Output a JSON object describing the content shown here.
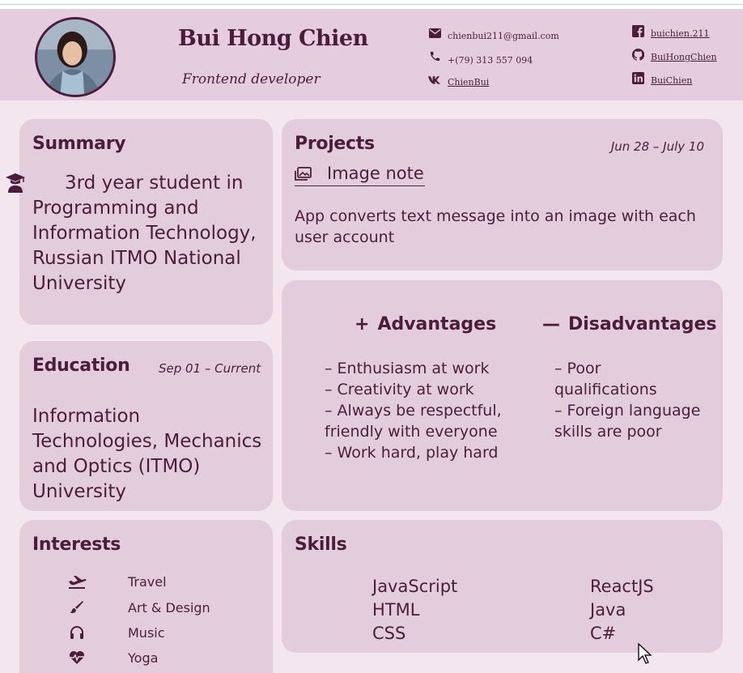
{
  "header": {
    "name": "Bui Hong Chien",
    "role": "Frontend developer",
    "email": "chienbui211@gmail.com",
    "phone": "+(79) 313 557 094",
    "vk": "ChienBui",
    "facebook": "buichien.211",
    "github": "BuiHongChien",
    "linkedin": "BuiChien"
  },
  "summary": {
    "title": "Summary",
    "text": "3rd year student in Programming and Information Technology, Russian ITMO National University"
  },
  "education": {
    "title": "Education",
    "date": "Sep 01 – Current",
    "text": "Information Technologies, Mechanics and Optics (ITMO) University"
  },
  "interests": {
    "title": "Interests",
    "items": [
      {
        "label": "Travel",
        "icon": "plane-icon"
      },
      {
        "label": "Art & Design",
        "icon": "brush-icon"
      },
      {
        "label": "Music",
        "icon": "headphones-icon"
      },
      {
        "label": "Yoga",
        "icon": "heartbeat-icon"
      }
    ]
  },
  "projects": {
    "title": "Projects",
    "date": "Jun 28 – July 10",
    "project_name": "Image note",
    "description": "App converts text message into an image with each user account"
  },
  "pros_cons": {
    "advantages_title": "Advantages",
    "advantages_sign": "+",
    "advantages": [
      "– Enthusiasm at work",
      "– Creativity at work",
      "– Always be respectful, friendly with everyone",
      "– Work hard, play hard"
    ],
    "disadvantages_title": "Disadvantages",
    "disadvantages_sign": "—",
    "disadvantages": [
      "– Poor qualifications",
      "– Foreign language skills are poor"
    ]
  },
  "skills": {
    "title": "Skills",
    "col1": [
      "JavaScript",
      "HTML",
      "CSS"
    ],
    "col2": [
      "ReactJS",
      "Java",
      "C#"
    ]
  },
  "colors": {
    "background": "#f4e6ef",
    "header": "#e5ccde",
    "card": "#e3cddc",
    "text": "#4a1d3d"
  }
}
